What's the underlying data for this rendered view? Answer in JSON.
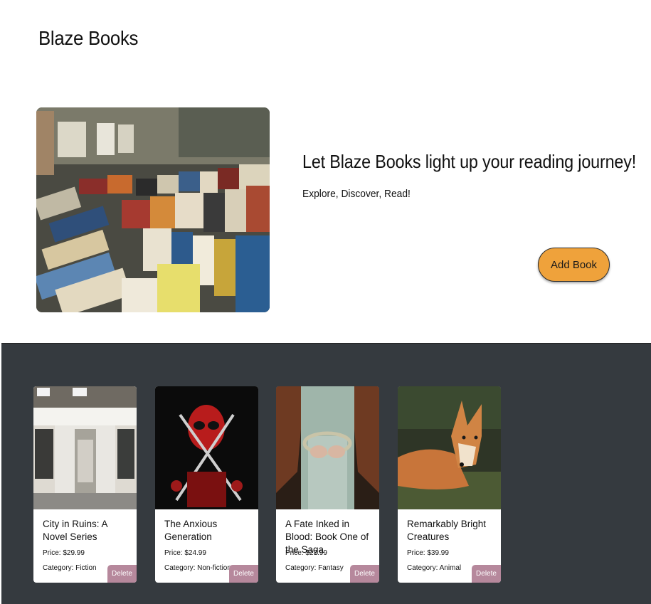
{
  "header": {
    "site_title": "Blaze Books"
  },
  "hero": {
    "image_description_icon": "bookstore-photo",
    "heading": "Let Blaze Books light up your reading journey!",
    "subheading": "Explore, Discover, Read!",
    "add_book_label": "Add Book"
  },
  "colors": {
    "accent": "#efa23b",
    "section_bg": "#353a3f",
    "delete_button": "#b6889c"
  },
  "books": [
    {
      "title": "City in Ruins: A Novel Series",
      "price": "Price: $29.99",
      "category": "Category: Fiction",
      "delete_label": "Delete",
      "cover": "storefront-photo"
    },
    {
      "title": "The Anxious Generation",
      "price": "Price: $24.99",
      "category": "Category: Non-fiction",
      "delete_label": "Delete",
      "cover": "masked-hero-photo"
    },
    {
      "title": "A Fate Inked in Blood: Book One of the Saga",
      "price": "Price: $27.99",
      "category": "Category: Fantasy",
      "delete_label": "Delete",
      "cover": "crown-in-hands-photo"
    },
    {
      "title": "Remarkably Bright Creatures",
      "price": "Price: $39.99",
      "category": "Category: Animal",
      "delete_label": "Delete",
      "cover": "fox-photo"
    }
  ]
}
